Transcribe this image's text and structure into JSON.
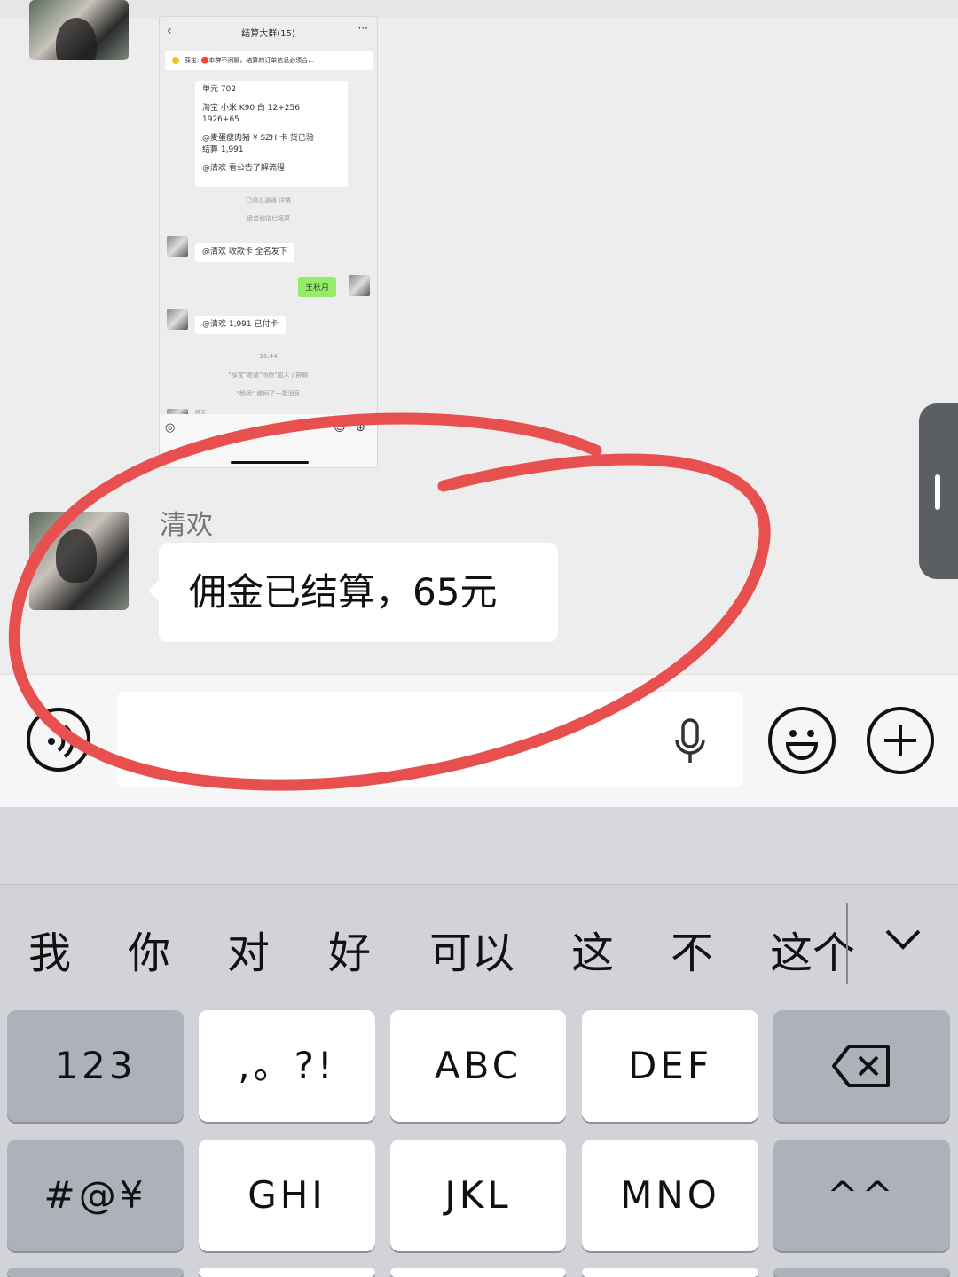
{
  "embedded_screenshot": {
    "title": "结算大群(15)",
    "notice": "薛宝: 🔴本群不闲聊，结算的订单信息必须合…",
    "bubble_lines": [
      "单元 702",
      "淘宝 小米 K90 白 12+256",
      "1926+65",
      "@麦蛋瘦肉猪 ¥ SZH 卡  货已验",
      "结算 1,991",
      "@清欢 看公告了解流程"
    ],
    "sys_1": "已退出通话 详情",
    "sys_2": "语音通话已结束",
    "msg_1": "@清欢 收款卡 全名发下",
    "green_msg": "王秋月",
    "msg_2": "@清欢    1,991   已付卡",
    "time": "16:44",
    "sys_3": "\"薛宝\"邀请\"杨杨\"加入了群聊",
    "sys_4": "\"杨杨\" 撤回了一条消息",
    "last_sender": "薛宝"
  },
  "message": {
    "sender": "清欢",
    "text": "佣金已结算，65元"
  },
  "candidates": [
    "我",
    "你",
    "对",
    "好",
    "可以",
    "这",
    "不",
    "这个"
  ],
  "keys": {
    "row1": [
      "123",
      ",。?!",
      "ABC",
      "DEF"
    ],
    "row2": [
      "#@¥",
      "GHI",
      "JKL",
      "MNO",
      "^^"
    ]
  },
  "colors": {
    "annotation_circle": "#e8504f",
    "green_bubble": "#95ec69"
  }
}
